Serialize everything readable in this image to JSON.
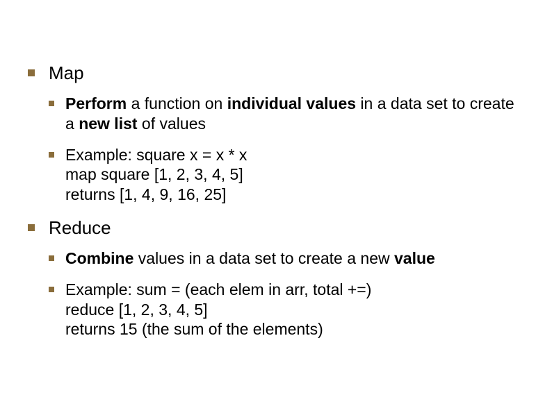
{
  "sections": [
    {
      "heading": "Map",
      "items": [
        {
          "runs": [
            {
              "t": "Perform",
              "b": true
            },
            {
              "t": " a function on ",
              "b": false
            },
            {
              "t": "individual values",
              "b": true
            },
            {
              "t": " in a data set to create a ",
              "b": false
            },
            {
              "t": "new list",
              "b": true
            },
            {
              "t": " of values",
              "b": false
            }
          ]
        },
        {
          "runs": [
            {
              "t": "Example: square x = x * x",
              "b": false
            },
            {
              "br": true
            },
            {
              "t": "map square [1, 2, 3, 4, 5]",
              "b": false
            },
            {
              "br": true
            },
            {
              "t": "returns [1, 4, 9, 16, 25]",
              "b": false
            }
          ]
        }
      ]
    },
    {
      "heading": "Reduce",
      "items": [
        {
          "runs": [
            {
              "t": "Combine",
              "b": true
            },
            {
              "t": " values in a data set to create a new ",
              "b": false
            },
            {
              "t": "value",
              "b": true
            }
          ]
        },
        {
          "runs": [
            {
              "t": "Example: sum = (each elem in arr, total +=)",
              "b": false
            },
            {
              "br": true
            },
            {
              "t": "reduce [1, 2, 3, 4, 5]",
              "b": false
            },
            {
              "br": true
            },
            {
              "t": "returns 15 (the sum of the elements)",
              "b": false
            }
          ]
        }
      ]
    }
  ]
}
